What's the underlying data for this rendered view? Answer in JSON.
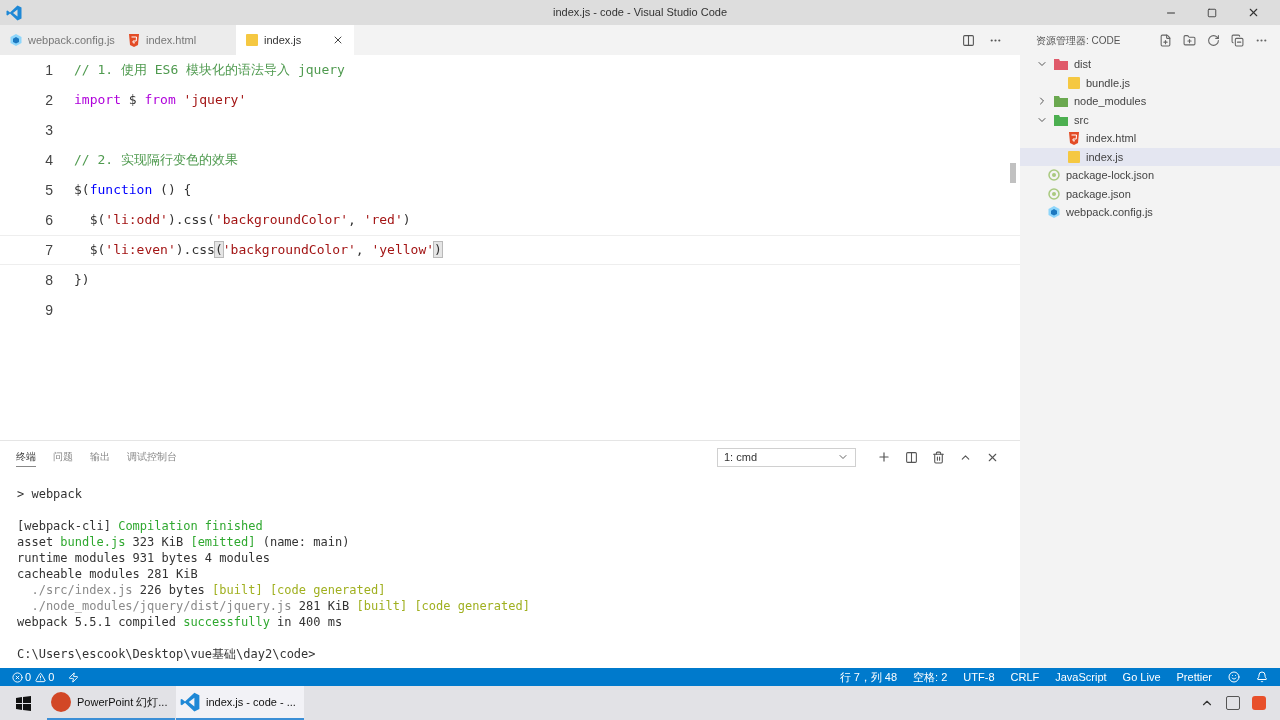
{
  "window": {
    "title": "index.js - code - Visual Studio Code"
  },
  "tabs": [
    {
      "label": "webpack.config.js",
      "kind": "webpack",
      "selected": false
    },
    {
      "label": "index.html",
      "kind": "html",
      "selected": false
    },
    {
      "label": "index.js",
      "kind": "js",
      "selected": true
    }
  ],
  "editor": {
    "lines": [
      {
        "number": "1",
        "tokens": [
          {
            "kind": "comment",
            "text": "// 1. 使用 ES6 模块化的语法导入 jquery"
          }
        ]
      },
      {
        "number": "2",
        "tokens": [
          {
            "kind": "keyword",
            "text": "import"
          },
          {
            "kind": "plain",
            "text": " $ "
          },
          {
            "kind": "keyword",
            "text": "from"
          },
          {
            "kind": "string",
            "text": " 'jquery'"
          }
        ]
      },
      {
        "number": "3"
      },
      {
        "number": "4",
        "tokens": [
          {
            "kind": "comment",
            "text": "// 2. 实现隔行变色的效果"
          }
        ]
      },
      {
        "number": "5",
        "tokens": [
          {
            "kind": "plain",
            "text": "$("
          },
          {
            "kind": "storage",
            "text": "function"
          },
          {
            "kind": "plain",
            "text": " () {"
          }
        ]
      },
      {
        "number": "6",
        "tokens": [
          {
            "kind": "plain",
            "text": "  $("
          },
          {
            "kind": "string",
            "text": "'li:odd'"
          },
          {
            "kind": "plain",
            "text": ").css("
          },
          {
            "kind": "string",
            "text": "'backgroundColor'"
          },
          {
            "kind": "plain",
            "text": ", "
          },
          {
            "kind": "string",
            "text": "'red'"
          },
          {
            "kind": "plain",
            "text": ")"
          }
        ]
      },
      {
        "number": "7",
        "current": true,
        "tokens": [
          {
            "kind": "plain",
            "text": "  $("
          },
          {
            "kind": "string",
            "text": "'li:even'"
          },
          {
            "kind": "plain",
            "text": ").css"
          },
          {
            "kind": "bracket",
            "text": "("
          },
          {
            "kind": "string",
            "text": "'backgroundColor'"
          },
          {
            "kind": "plain",
            "text": ", "
          },
          {
            "kind": "string",
            "text": "'yellow'"
          },
          {
            "kind": "bracket",
            "text": ")"
          }
        ]
      },
      {
        "number": "8",
        "tokens": [
          {
            "kind": "plain",
            "text": "})"
          }
        ]
      },
      {
        "number": "9"
      }
    ]
  },
  "panel": {
    "tabs": [
      {
        "label": "终端",
        "selected": true
      },
      {
        "label": "问题",
        "selected": false
      },
      {
        "label": "输出",
        "selected": false
      },
      {
        "label": "调试控制台",
        "selected": false
      }
    ],
    "terminal_select": "1: cmd",
    "terminal": [
      {
        "lines": [
          {
            "segments": [
              {
                "kind": "plain",
                "text": "> webpack"
              }
            ]
          }
        ]
      },
      {
        "lines": [
          {
            "segments": [
              {
                "kind": "plain",
                "text": "[webpack-cli] "
              },
              {
                "kind": "green",
                "text": "Compilation finished"
              }
            ]
          },
          {
            "segments": [
              {
                "kind": "plain",
                "text": "asset "
              },
              {
                "kind": "green",
                "text": "bundle.js"
              },
              {
                "kind": "plain",
                "text": " 323 KiB "
              },
              {
                "kind": "green",
                "text": "[emitted]"
              },
              {
                "kind": "plain",
                "text": " (name: main)"
              }
            ]
          },
          {
            "segments": [
              {
                "kind": "plain",
                "text": "runtime modules 931 bytes 4 modules"
              }
            ]
          },
          {
            "segments": [
              {
                "kind": "plain",
                "text": "cacheable modules 281 KiB"
              }
            ]
          },
          {
            "segments": [
              {
                "kind": "gray",
                "text": "  ./src/index.js"
              },
              {
                "kind": "plain",
                "text": " 226 bytes "
              },
              {
                "kind": "olive",
                "text": "[built] [code generated]"
              }
            ]
          },
          {
            "segments": [
              {
                "kind": "gray",
                "text": "  ./node_modules/jquery/dist/jquery.js"
              },
              {
                "kind": "plain",
                "text": " 281 KiB "
              },
              {
                "kind": "olive",
                "text": "[built] [code generated]"
              }
            ]
          },
          {
            "segments": [
              {
                "kind": "plain",
                "text": "webpack 5.5.1 compiled "
              },
              {
                "kind": "green",
                "text": "successfully"
              },
              {
                "kind": "plain",
                "text": " in 400 ms"
              }
            ]
          }
        ]
      },
      {
        "lines": [
          {
            "segments": [
              {
                "kind": "plain",
                "text": "C:\\Users\\escook\\Desktop\\vue基础\\day2\\code>"
              }
            ]
          }
        ]
      }
    ]
  },
  "explorer": {
    "title": "资源管理器: CODE",
    "items": [
      {
        "label": "dist",
        "kind": "folder",
        "color": "#e05a6a",
        "expanded": true,
        "selected": false,
        "children": [
          {
            "label": "bundle.js",
            "kind": "js",
            "selected": false
          }
        ]
      },
      {
        "label": "node_modules",
        "kind": "folder",
        "color": "#6aa84f",
        "expanded": false,
        "selected": false
      },
      {
        "label": "src",
        "kind": "folder",
        "color": "#4caf50",
        "expanded": true,
        "selected": false,
        "children": [
          {
            "label": "index.html",
            "kind": "html",
            "selected": false
          },
          {
            "label": "index.js",
            "kind": "js",
            "selected": true
          }
        ]
      },
      {
        "label": "package-lock.json",
        "kind": "json",
        "selected": false
      },
      {
        "label": "package.json",
        "kind": "json",
        "selected": false
      },
      {
        "label": "webpack.config.js",
        "kind": "webpack",
        "selected": false
      }
    ]
  },
  "status_bar": {
    "errors": "0",
    "warnings": "0",
    "right": [
      "行 7，列 48",
      "空格: 2",
      "UTF-8",
      "CRLF",
      "JavaScript",
      "Go Live",
      "Prettier"
    ]
  },
  "taskbar": [
    {
      "label": "PowerPoint 幻灯...",
      "kind": "powerpoint",
      "selected": false
    },
    {
      "label": "index.js - code - ...",
      "kind": "vscode",
      "selected": true
    }
  ]
}
